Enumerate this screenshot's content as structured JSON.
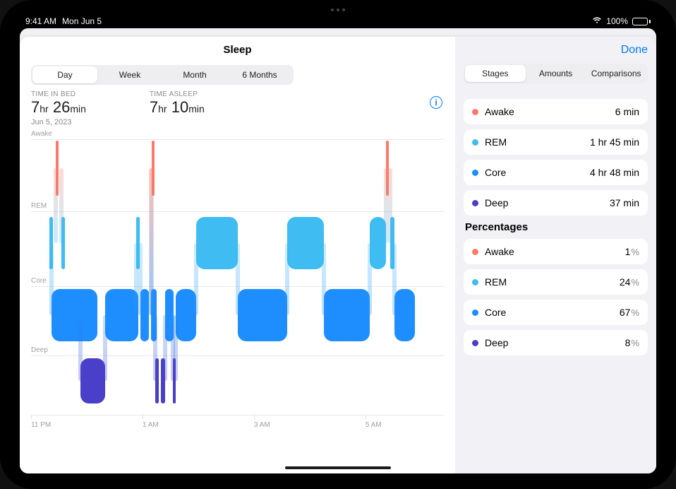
{
  "status": {
    "time": "9:41 AM",
    "date": "Mon Jun 5",
    "battery_pct": "100%"
  },
  "header": {
    "title": "Sleep",
    "done": "Done"
  },
  "range_tabs": [
    "Day",
    "Week",
    "Month",
    "6 Months"
  ],
  "range_active": 0,
  "metrics": {
    "bed_label": "TIME IN BED",
    "bed_h": "7",
    "bed_hu": "hr",
    "bed_m": "26",
    "bed_mu": "min",
    "asleep_label": "TIME ASLEEP",
    "asleep_h": "7",
    "asleep_hu": "hr",
    "asleep_m": "10",
    "asleep_mu": "min",
    "date": "Jun 5, 2023"
  },
  "chart": {
    "stages": [
      "Awake",
      "REM",
      "Core",
      "Deep"
    ],
    "x_ticks": [
      "11 PM",
      "1 AM",
      "3 AM",
      "5 AM"
    ]
  },
  "side_tabs": [
    "Stages",
    "Amounts",
    "Comparisons"
  ],
  "side_active": 0,
  "colors": {
    "awake": "#ff7a66",
    "rem": "#3fbcf2",
    "core": "#1e8eff",
    "deep": "#4a3fc8"
  },
  "stages_list": [
    {
      "name": "Awake",
      "value": "6 min",
      "colorkey": "awake"
    },
    {
      "name": "REM",
      "value": "1 hr 45 min",
      "colorkey": "rem"
    },
    {
      "name": "Core",
      "value": "4 hr 48 min",
      "colorkey": "core"
    },
    {
      "name": "Deep",
      "value": "37 min",
      "colorkey": "deep"
    }
  ],
  "percentages_header": "Percentages",
  "percentages": [
    {
      "name": "Awake",
      "value": "1",
      "colorkey": "awake"
    },
    {
      "name": "REM",
      "value": "24",
      "colorkey": "rem"
    },
    {
      "name": "Core",
      "value": "67",
      "colorkey": "core"
    },
    {
      "name": "Deep",
      "value": "8",
      "colorkey": "deep"
    }
  ],
  "chart_data": {
    "type": "sleep-hypnogram",
    "title": "Sleep",
    "ylabel_categories": [
      "Awake",
      "REM",
      "Core",
      "Deep"
    ],
    "x_start": "11 PM",
    "x_ticks": [
      "11 PM",
      "1 AM",
      "3 AM",
      "5 AM"
    ],
    "duration_hours": 7.43,
    "segments": [
      {
        "stage": "REM",
        "start_pct": 4.5,
        "width_pct": 0.8
      },
      {
        "stage": "Awake",
        "start_pct": 6.0,
        "width_pct": 0.7
      },
      {
        "stage": "REM",
        "start_pct": 7.4,
        "width_pct": 0.8
      },
      {
        "stage": "Core",
        "start_pct": 5.0,
        "width_pct": 11.0
      },
      {
        "stage": "Deep",
        "start_pct": 12.0,
        "width_pct": 6.0
      },
      {
        "stage": "Core",
        "start_pct": 18.0,
        "width_pct": 8.0
      },
      {
        "stage": "REM",
        "start_pct": 25.5,
        "width_pct": 0.8
      },
      {
        "stage": "Core",
        "start_pct": 26.5,
        "width_pct": 2.0
      },
      {
        "stage": "Awake",
        "start_pct": 29.2,
        "width_pct": 0.7
      },
      {
        "stage": "Core",
        "start_pct": 29.0,
        "width_pct": 1.5
      },
      {
        "stage": "Deep",
        "start_pct": 30.0,
        "width_pct": 1.0
      },
      {
        "stage": "Deep",
        "start_pct": 31.5,
        "width_pct": 1.0
      },
      {
        "stage": "Core",
        "start_pct": 32.5,
        "width_pct": 2.0
      },
      {
        "stage": "Deep",
        "start_pct": 34.3,
        "width_pct": 0.8
      },
      {
        "stage": "Core",
        "start_pct": 35.0,
        "width_pct": 5.0
      },
      {
        "stage": "REM",
        "start_pct": 40.0,
        "width_pct": 10.0
      },
      {
        "stage": "Core",
        "start_pct": 50.0,
        "width_pct": 12.0
      },
      {
        "stage": "REM",
        "start_pct": 62.0,
        "width_pct": 9.0
      },
      {
        "stage": "Core",
        "start_pct": 71.0,
        "width_pct": 11.0
      },
      {
        "stage": "REM",
        "start_pct": 82.0,
        "width_pct": 4.0
      },
      {
        "stage": "Awake",
        "start_pct": 86.0,
        "width_pct": 0.7
      },
      {
        "stage": "REM",
        "start_pct": 87.0,
        "width_pct": 1.0
      },
      {
        "stage": "Core",
        "start_pct": 88.0,
        "width_pct": 5.0
      }
    ]
  }
}
